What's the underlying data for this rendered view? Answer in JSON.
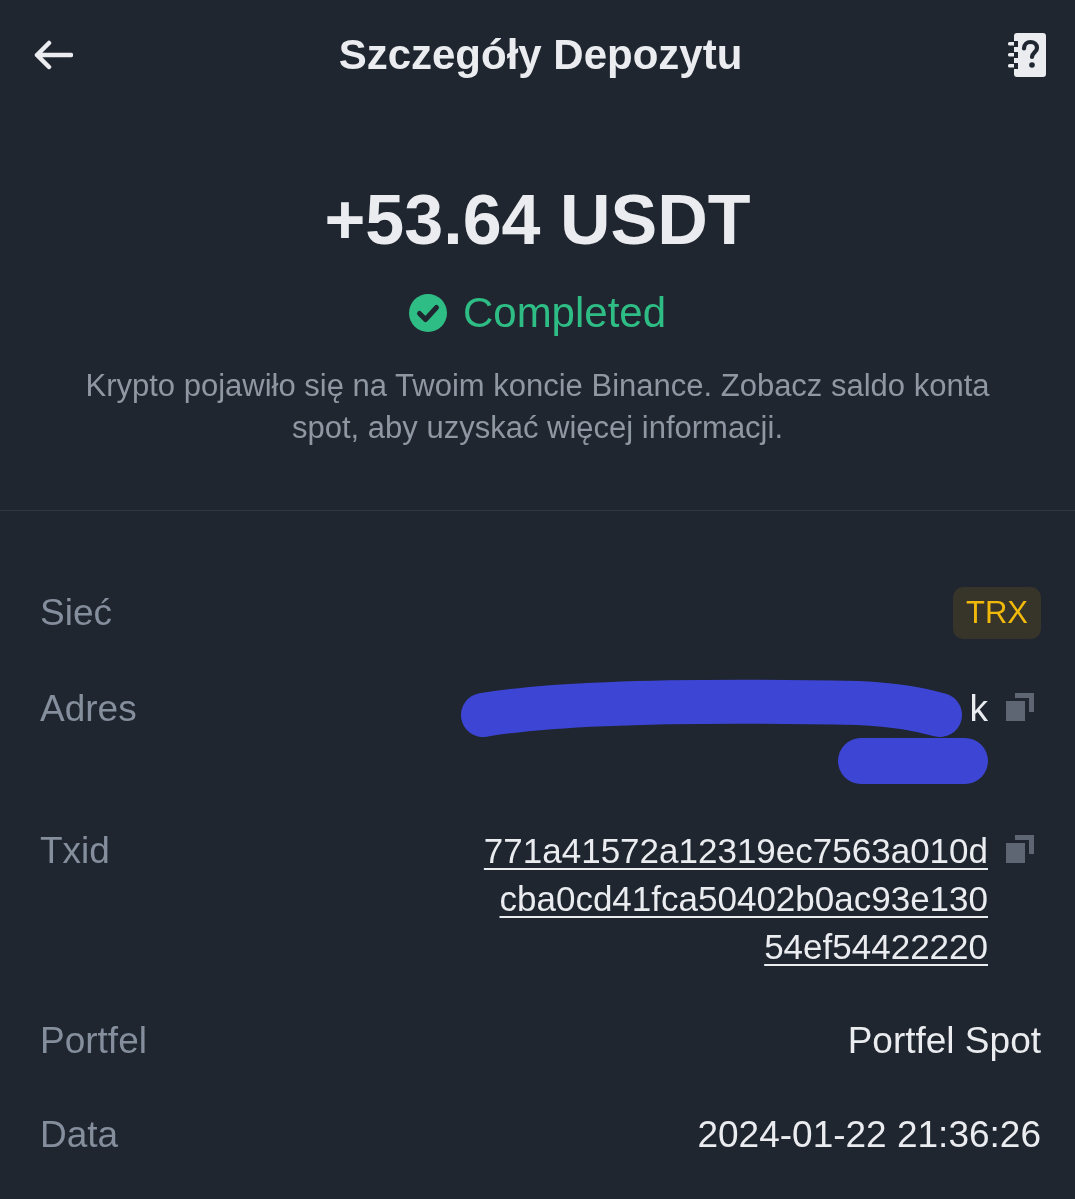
{
  "header": {
    "title": "Szczegóły Depozytu"
  },
  "summary": {
    "amount": "+53.64 USDT",
    "status": {
      "kind": "completed",
      "label": "Completed"
    },
    "note": "Krypto pojawiło się na Twoim koncie Binance. Zobacz saldo konta spot, aby uzyskać więcej informacji."
  },
  "details": [
    {
      "kind": "badge",
      "label": "Sieć",
      "value": "TRX"
    },
    {
      "kind": "address",
      "label": "Adres",
      "value": "k",
      "redacted": true,
      "copyable": true
    },
    {
      "kind": "link",
      "label": "Txid",
      "value": "771a41572a12319ec7563a010dcba0cd41fca50402b0ac93e13054ef54422220",
      "copyable": true
    },
    {
      "kind": "text",
      "label": "Portfel",
      "value": "Portfel Spot"
    },
    {
      "kind": "text",
      "label": "Data",
      "value": "2024-01-22 21:36:26"
    }
  ]
}
